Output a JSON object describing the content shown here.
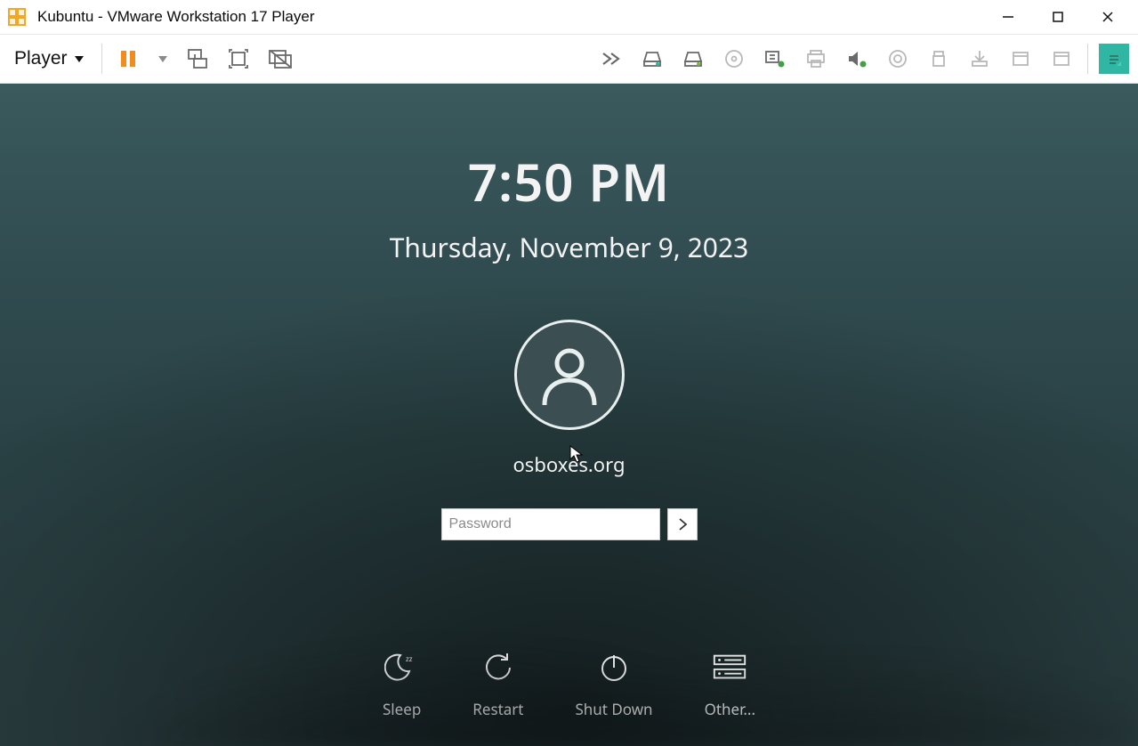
{
  "window": {
    "title": "Kubuntu - VMware Workstation 17 Player"
  },
  "toolbar": {
    "player_label": "Player"
  },
  "lock": {
    "time": "7:50 PM",
    "date": "Thursday, November 9, 2023",
    "username": "osboxes.org",
    "password_placeholder": "Password",
    "actions": {
      "sleep": "Sleep",
      "restart": "Restart",
      "shutdown": "Shut Down",
      "other": "Other..."
    }
  }
}
